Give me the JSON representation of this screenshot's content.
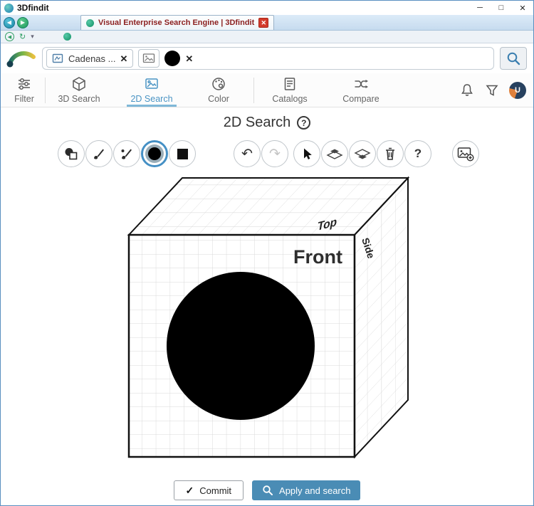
{
  "window": {
    "title": "3Dfindit"
  },
  "window_controls": {
    "minimize": "─",
    "maximize": "□",
    "close": "✕"
  },
  "browser": {
    "tab_title": "Visual Enterprise Search Engine | 3Dfindit",
    "tab_close": "✕",
    "back": "◀",
    "forward": "▶",
    "refresh": "↻",
    "dropdown": "▾"
  },
  "search": {
    "catalog_chip": "Cadenas ...",
    "remove": "✕",
    "input_value": ""
  },
  "nav": {
    "items": [
      {
        "label": "Filter"
      },
      {
        "label": "3D Search"
      },
      {
        "label": "2D Search"
      },
      {
        "label": "Color"
      },
      {
        "label": "Catalogs"
      },
      {
        "label": "Compare"
      }
    ],
    "active": "2D Search",
    "user_initial": "U"
  },
  "page": {
    "heading": "2D Search",
    "help": "?"
  },
  "tools": {
    "undo": "↶",
    "redo": "↷",
    "help": "?"
  },
  "canvas": {
    "top_label": "Top",
    "front_label": "Front",
    "side_label": "Side"
  },
  "footer": {
    "commit_check": "✓",
    "commit_label": "Commit",
    "apply_label": "Apply and search"
  },
  "colors": {
    "accent_blue": "#4a8cb5",
    "active_nav_blue": "#4a94c4",
    "nav_underline": "#7fb8d8",
    "tab_title_red": "#8b1f1f",
    "selected_tool_ring": "#4590c5",
    "sketch_color": "#000000"
  }
}
